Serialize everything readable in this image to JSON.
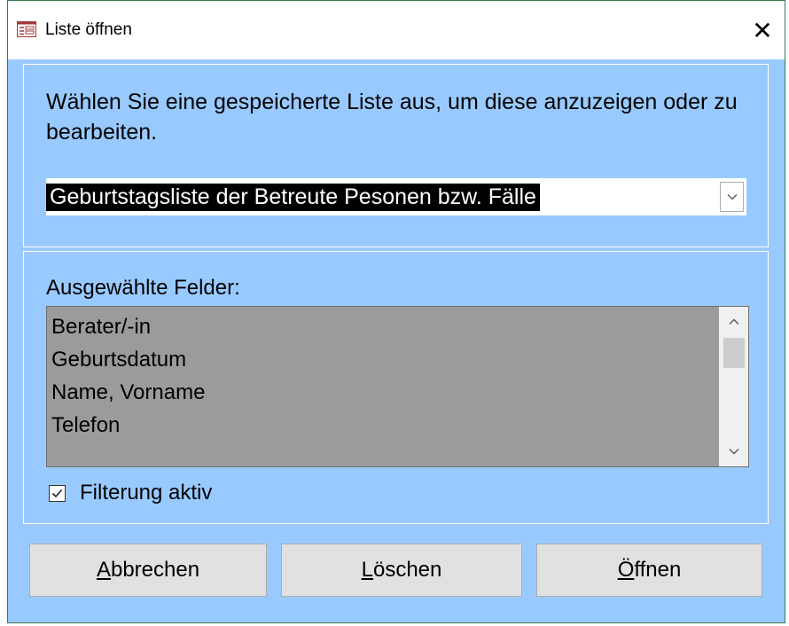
{
  "window": {
    "title": "Liste öffnen",
    "close_glyph": "✕"
  },
  "top_panel": {
    "instruction": "Wählen Sie eine gespeicherte Liste aus, um diese anzuzeigen oder zu bearbeiten.",
    "selected_list": "Geburtstagsliste der Betreute Pesonen bzw. Fälle"
  },
  "bottom_panel": {
    "fields_label": "Ausgewählte Felder:",
    "fields": [
      "Berater/-in",
      "Geburtsdatum",
      "Name, Vorname",
      "Telefon"
    ],
    "filter_label": "Filterung aktiv",
    "filter_checked": true
  },
  "buttons": {
    "cancel": {
      "accel": "A",
      "rest": "bbrechen"
    },
    "delete": {
      "accel": "L",
      "rest": "öschen"
    },
    "open": {
      "accel": "Ö",
      "rest": "ffnen"
    }
  },
  "colors": {
    "dialog_background": "#99caff",
    "list_background": "#9b9b9b",
    "button_face": "#e1e1e1",
    "selection": "#000000"
  },
  "icons": {
    "app": "form-icon",
    "close": "close-icon",
    "combo": "chevron-down-icon",
    "scroll_up": "chevron-up-icon",
    "scroll_down": "chevron-down-icon",
    "checkbox": "checkmark-icon"
  }
}
